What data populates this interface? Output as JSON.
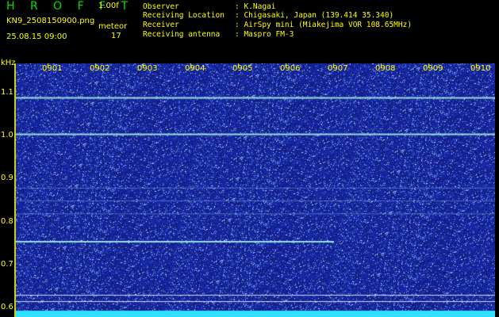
{
  "header": {
    "software": "H R O F F T",
    "version": "1.00f",
    "filename": "KN9_2508150900.png",
    "datetime": "25.08.15 09:00",
    "meteor_label": "meteor",
    "meteor_count": "17"
  },
  "info": [
    {
      "label": "Observer",
      "value": ": K.Nagai"
    },
    {
      "label": "Receiving Location",
      "value": ": Chigasaki, Japan (139.414 35.340)"
    },
    {
      "label": "Receiver",
      "value": ": AirSpy mini (Miakejima VOR 108.65MHz)"
    },
    {
      "label": "Receiving antenna",
      "value": ": Maspro FM-3"
    }
  ],
  "axis": {
    "y_unit": "kHz",
    "y_ticks": [
      "1.1",
      "1.0",
      "0.9",
      "0.8",
      "0.7",
      "0.6"
    ],
    "x_ticks": [
      "0901",
      "0902",
      "0903",
      "0904",
      "0905",
      "0906",
      "0907",
      "0908",
      "0909",
      "0910"
    ]
  },
  "colors": {
    "background": "#000000",
    "label": "#ffff00",
    "title": "#00e000",
    "spectrum_base": "#1e2ea8",
    "carrier": "#9ee8e0",
    "baseline": "#30e0ff"
  },
  "chart_data": {
    "type": "heatmap",
    "x_label": "",
    "y_label": "kHz",
    "y_range": [
      0.58,
      1.17
    ],
    "x_categories": [
      "0901",
      "0902",
      "0903",
      "0904",
      "0905",
      "0906",
      "0907",
      "0908",
      "0909",
      "0910"
    ],
    "traces": [
      {
        "freq_khz": 1.09,
        "start": "0901",
        "end": "0910",
        "strength": "strong"
      },
      {
        "freq_khz": 1.005,
        "start": "0901",
        "end": "0910",
        "strength": "strong"
      },
      {
        "freq_khz": 0.755,
        "start": "0901",
        "end": "0907",
        "strength": "strong"
      },
      {
        "freq_khz": 0.82,
        "start": "0901",
        "end": "0910",
        "strength": "faint"
      },
      {
        "freq_khz": 0.85,
        "start": "0901",
        "end": "0910",
        "strength": "faint"
      },
      {
        "freq_khz": 0.88,
        "start": "0901",
        "end": "0910",
        "strength": "faint"
      }
    ]
  }
}
